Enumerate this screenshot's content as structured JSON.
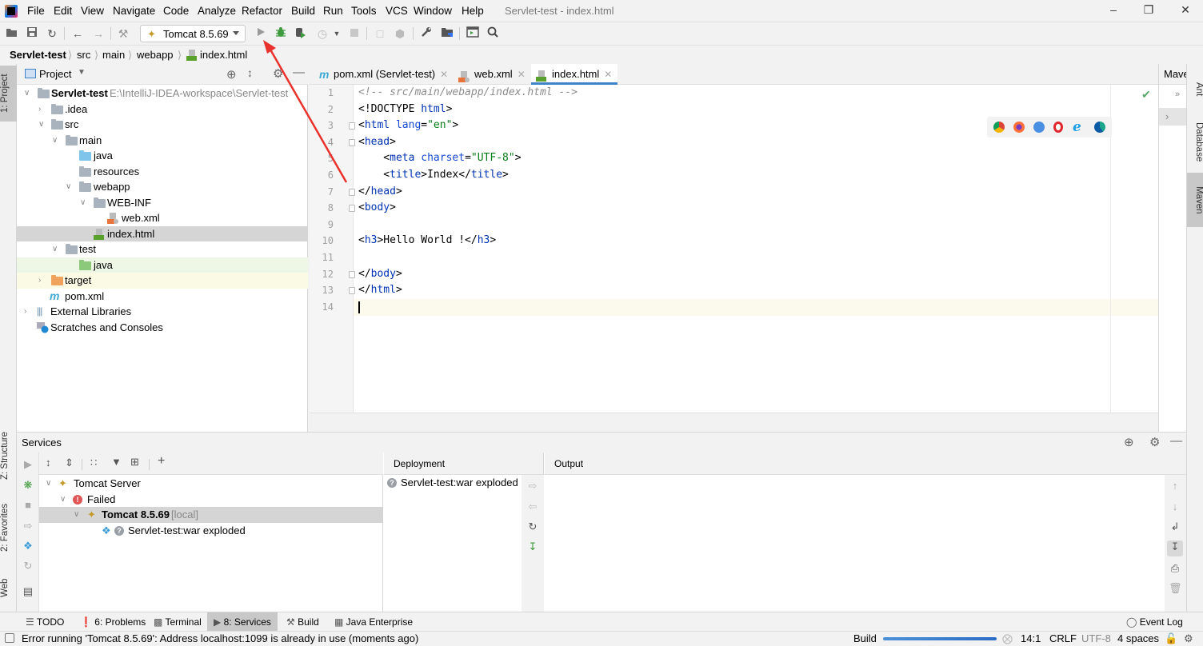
{
  "window": {
    "title": "Servlet-test - index.html",
    "controls": [
      "minimize",
      "restore",
      "close"
    ]
  },
  "menu": [
    "File",
    "Edit",
    "View",
    "Navigate",
    "Code",
    "Analyze",
    "Refactor",
    "Build",
    "Run",
    "Tools",
    "VCS",
    "Window",
    "Help"
  ],
  "toolbar": {
    "run_config": "Tomcat 8.5.69",
    "buttons": [
      "open-icon",
      "save-icon",
      "sync-icon",
      "back-icon",
      "forward-icon",
      "build-icon",
      "run-icon",
      "debug-icon",
      "coverage-icon",
      "profile-icon",
      "stop-icon",
      "attach-icon",
      "deploy-icon",
      "settings-wrench-icon",
      "project-structure-icon",
      "terminal-icon",
      "search-icon"
    ]
  },
  "breadcrumb": [
    "Servlet-test",
    "src",
    "main",
    "webapp",
    "index.html"
  ],
  "left_strip": {
    "project_tab": "1: Project",
    "structure_tab": "Z: Structure",
    "favorites_tab": "2: Favorites",
    "web_tab": "Web"
  },
  "right_strip": {
    "ant": "Ant",
    "database": "Database",
    "maven": "Maven"
  },
  "project_panel": {
    "title": "Project",
    "tree": [
      {
        "label": "Servlet-test",
        "path": "E:\\IntelliJ-IDEA-workspace\\Servlet-test",
        "bold": true,
        "expanded": true
      },
      {
        "label": ".idea",
        "expanded": false
      },
      {
        "label": "src",
        "expanded": true
      },
      {
        "label": "main",
        "expanded": true
      },
      {
        "label": "java"
      },
      {
        "label": "resources"
      },
      {
        "label": "webapp",
        "expanded": true
      },
      {
        "label": "WEB-INF",
        "expanded": true
      },
      {
        "label": "web.xml"
      },
      {
        "label": "index.html",
        "selected": true
      },
      {
        "label": "test",
        "expanded": true
      },
      {
        "label": "java"
      },
      {
        "label": "target",
        "expanded": false
      },
      {
        "label": "pom.xml"
      },
      {
        "label": "External Libraries",
        "expanded": false
      },
      {
        "label": "Scratches and Consoles"
      }
    ]
  },
  "editor": {
    "tabs": [
      {
        "label": "pom.xml (Servlet-test)",
        "active": false
      },
      {
        "label": "web.xml",
        "active": false
      },
      {
        "label": "index.html",
        "active": true
      }
    ],
    "lines": [
      "<!-- src/main/webapp/index.html -->",
      "<!DOCTYPE html>",
      "<html lang=\"en\">",
      "<head>",
      "    <meta charset=\"UTF-8\">",
      "    <title>Index</title>",
      "</head>",
      "<body>",
      "",
      "<h3>Hello World !</h3>",
      "",
      "</body>",
      "</html>",
      ""
    ],
    "line_numbers": [
      "1",
      "2",
      "3",
      "4",
      "5",
      "6",
      "7",
      "8",
      "9",
      "10",
      "11",
      "12",
      "13",
      "14"
    ],
    "current_line": 14,
    "browsers": [
      "chrome",
      "firefox",
      "safari",
      "opera",
      "internet-explorer",
      "edge"
    ]
  },
  "maven_panel": {
    "title": "Mave"
  },
  "services": {
    "title": "Services",
    "tree": [
      {
        "label": "Tomcat Server"
      },
      {
        "label": "Failed"
      },
      {
        "label": "Tomcat 8.5.69",
        "suffix": "[local]",
        "selected": true
      },
      {
        "label": "Servlet-test:war exploded"
      }
    ],
    "deployment_header": "Deployment",
    "deployment_item": "Servlet-test:war exploded",
    "output_header": "Output"
  },
  "bottom_tabs": [
    {
      "label": "TODO",
      "active": false
    },
    {
      "label": "6: Problems",
      "active": false
    },
    {
      "label": "Terminal",
      "active": false
    },
    {
      "label": "8: Services",
      "active": true
    },
    {
      "label": "Build",
      "active": false
    },
    {
      "label": "Java Enterprise",
      "active": false
    }
  ],
  "event_log": "Event Log",
  "status": {
    "message": "Error running 'Tomcat 8.5.69': Address localhost:1099 is already in use (moments ago)",
    "build_label": "Build",
    "position": "14:1",
    "line_sep": "CRLF",
    "encoding": "UTF-8",
    "indent": "4 spaces"
  },
  "colors": {
    "accent": "#4083c9",
    "error": "#e05555",
    "debug_green": "#3e9a3e"
  }
}
